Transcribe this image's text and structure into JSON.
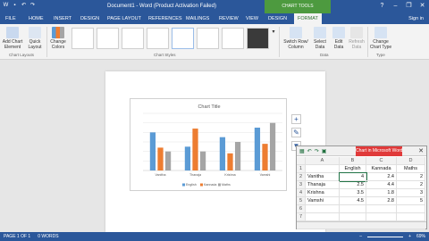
{
  "titlebar": {
    "doc_title": "Document1 - Word (Product Activation Failed)",
    "chart_tools": "CHART TOOLS",
    "help": "?",
    "minimize": "–",
    "restore": "❐",
    "close": "✕"
  },
  "tabs": {
    "file": "FILE",
    "items": [
      "HOME",
      "INSERT",
      "DESIGN",
      "PAGE LAYOUT",
      "REFERENCES",
      "MAILINGS",
      "REVIEW",
      "VIEW",
      "DESIGN",
      "FORMAT"
    ],
    "user": "Sign in"
  },
  "ribbon": {
    "add_chart_element": "Add Chart Element",
    "quick_layout": "Quick Layout",
    "change_colors": "Change Colors",
    "switch_row_column": "Switch Row/ Column",
    "select_data": "Select Data",
    "edit_data": "Edit Data",
    "refresh_data": "Refresh Data",
    "change_chart_type": "Change Chart Type",
    "group_chart_layouts": "Chart Layouts",
    "group_chart_styles": "Chart Styles",
    "group_data": "Data",
    "group_type": "Type"
  },
  "chart_data": {
    "type": "bar",
    "title": "Chart Title",
    "categories": [
      "Vanitha",
      "Thanaja",
      "Krishna",
      "Vamshi"
    ],
    "series": [
      {
        "name": "English",
        "values": [
          4,
          2.5,
          3.5,
          4.5
        ],
        "color": "#5b9bd5"
      },
      {
        "name": "Kannada",
        "values": [
          2.4,
          4.4,
          1.8,
          2.8
        ],
        "color": "#ed7d31"
      },
      {
        "name": "Maths",
        "values": [
          2,
          2,
          3,
          5
        ],
        "color": "#a5a5a5"
      }
    ],
    "ylim": [
      0,
      6
    ],
    "grid": true,
    "legend": "bottom"
  },
  "excel": {
    "title": "Chart in Microsoft Word",
    "columns": [
      "",
      "A",
      "B",
      "C",
      "D"
    ],
    "rows": [
      {
        "n": "1",
        "a": "",
        "b": "English",
        "c": "Kannada",
        "d": "Maths"
      },
      {
        "n": "2",
        "a": "Vanitha",
        "b": "4",
        "c": "2.4",
        "d": "2"
      },
      {
        "n": "3",
        "a": "Thanaja",
        "b": "2.5",
        "c": "4.4",
        "d": "2"
      },
      {
        "n": "4",
        "a": "Krishna",
        "b": "3.5",
        "c": "1.8",
        "d": "3"
      },
      {
        "n": "5",
        "a": "Vamshi",
        "b": "4.5",
        "c": "2.8",
        "d": "5"
      },
      {
        "n": "6",
        "a": "",
        "b": "",
        "c": "",
        "d": ""
      },
      {
        "n": "7",
        "a": "",
        "b": "",
        "c": "",
        "d": ""
      },
      {
        "n": "8",
        "a": "",
        "b": "",
        "c": "",
        "d": ""
      }
    ]
  },
  "status": {
    "page": "PAGE 1 OF 1",
    "words": "0 WORDS",
    "zoom": "69%"
  },
  "colors": {
    "word_blue": "#2b579a",
    "chart_tools_green": "#4d9a3f",
    "excel_red": "#e03a3a"
  }
}
